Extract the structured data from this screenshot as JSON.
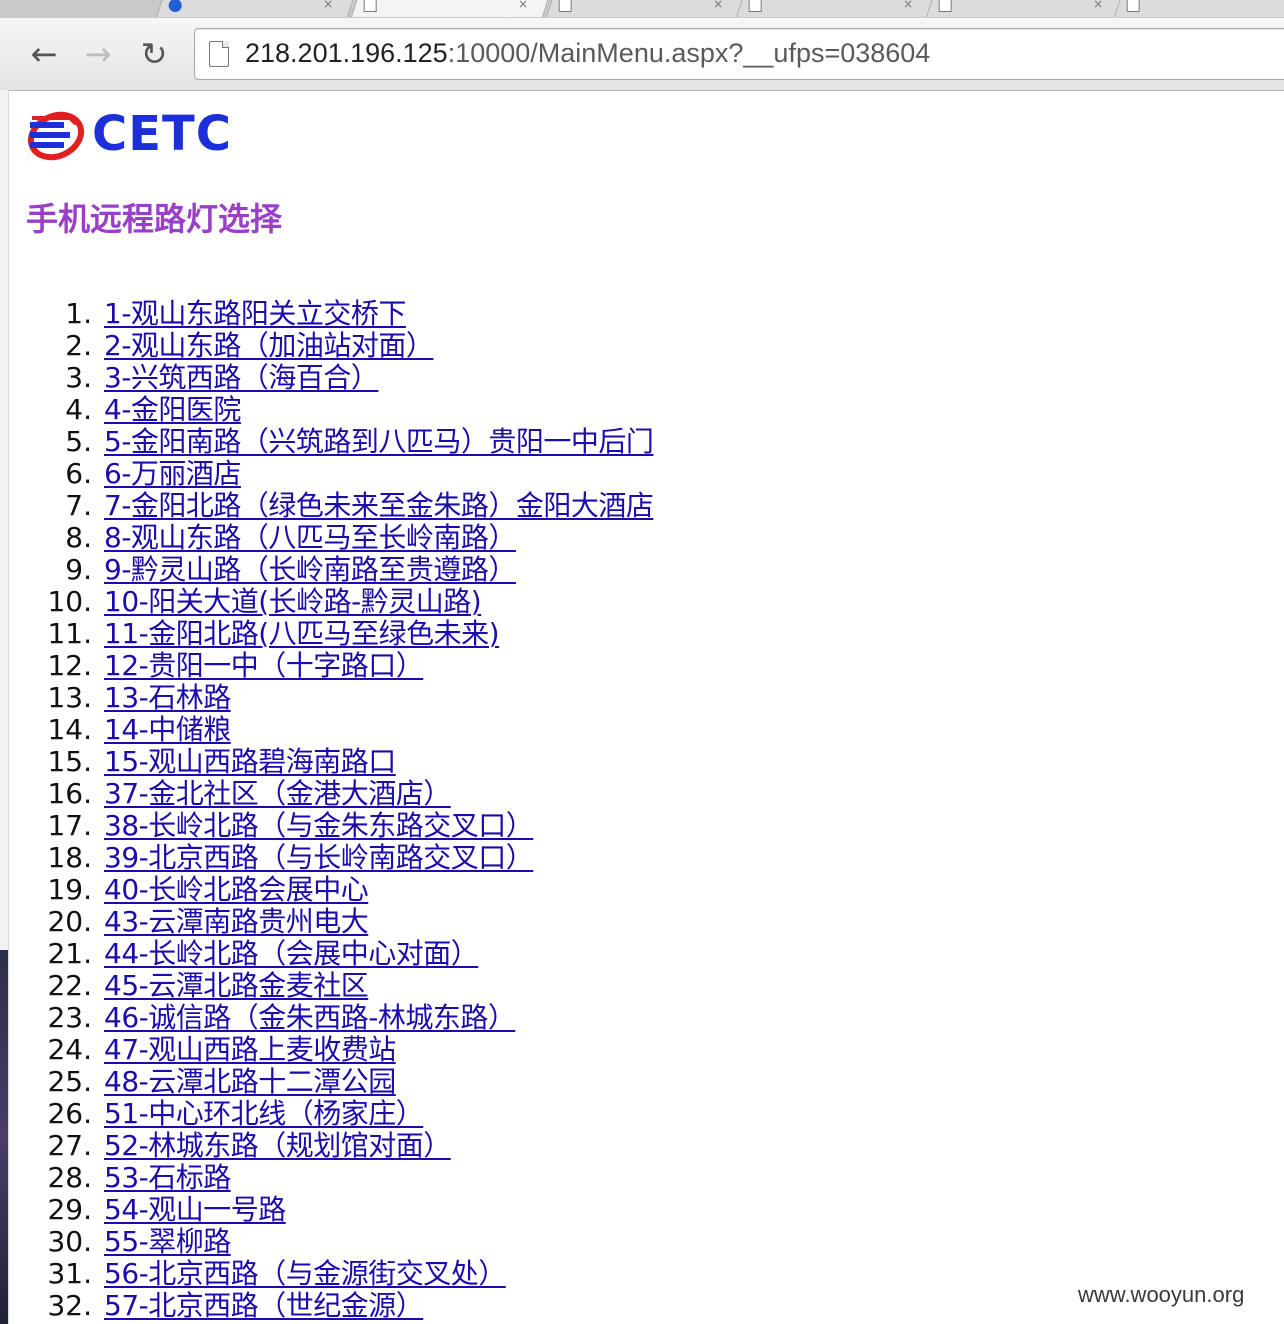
{
  "browser": {
    "tabs": [
      {
        "icon": "search-favicon-icon"
      },
      {
        "icon": "page-icon"
      },
      {
        "icon": "page-icon"
      },
      {
        "icon": "page-icon"
      },
      {
        "icon": "page-icon"
      },
      {
        "icon": "page-icon"
      }
    ],
    "url_host": "218.201.196.125",
    "url_rest": ":10000/MainMenu.aspx?__ufps=038604",
    "back_glyph": "←",
    "forward_glyph": "→",
    "reload_glyph": "↻"
  },
  "logo": {
    "text": "CETC",
    "brand_color": "#1c2fd8",
    "swoosh_color": "#e02020"
  },
  "page": {
    "title": "手机远程路灯选择",
    "title_color": "#9b3fc9",
    "link_color": "#1a0dab"
  },
  "roads": [
    {
      "num": "1.",
      "label": "1-观山东路阳关立交桥下"
    },
    {
      "num": "2.",
      "label": "2-观山东路（加油站对面）"
    },
    {
      "num": "3.",
      "label": "3-兴筑西路（海百合）"
    },
    {
      "num": "4.",
      "label": "4-金阳医院"
    },
    {
      "num": "5.",
      "label": "5-金阳南路（兴筑路到八匹马）贵阳一中后门"
    },
    {
      "num": "6.",
      "label": "6-万丽酒店"
    },
    {
      "num": "7.",
      "label": "7-金阳北路（绿色未来至金朱路）金阳大酒店"
    },
    {
      "num": "8.",
      "label": "8-观山东路（八匹马至长岭南路）"
    },
    {
      "num": "9.",
      "label": "9-黔灵山路（长岭南路至贵遵路）"
    },
    {
      "num": "10.",
      "label": "10-阳关大道(长岭路-黔灵山路)"
    },
    {
      "num": "11.",
      "label": "11-金阳北路(八匹马至绿色未来)"
    },
    {
      "num": "12.",
      "label": "12-贵阳一中（十字路口）"
    },
    {
      "num": "13.",
      "label": "13-石林路"
    },
    {
      "num": "14.",
      "label": "14-中储粮"
    },
    {
      "num": "15.",
      "label": "15-观山西路碧海南路口"
    },
    {
      "num": "16.",
      "label": "37-金北社区（金港大酒店）"
    },
    {
      "num": "17.",
      "label": "38-长岭北路（与金朱东路交叉口）"
    },
    {
      "num": "18.",
      "label": "39-北京西路（与长岭南路交叉口）"
    },
    {
      "num": "19.",
      "label": "40-长岭北路会展中心"
    },
    {
      "num": "20.",
      "label": "43-云潭南路贵州电大"
    },
    {
      "num": "21.",
      "label": "44-长岭北路（会展中心对面）"
    },
    {
      "num": "22.",
      "label": "45-云潭北路金麦社区"
    },
    {
      "num": "23.",
      "label": "46-诚信路（金朱西路-林城东路）"
    },
    {
      "num": "24.",
      "label": "47-观山西路上麦收费站"
    },
    {
      "num": "25.",
      "label": "48-云潭北路十二潭公园"
    },
    {
      "num": "26.",
      "label": "51-中心环北线（杨家庄）"
    },
    {
      "num": "27.",
      "label": "52-林城东路（规划馆对面）"
    },
    {
      "num": "28.",
      "label": "53-石标路"
    },
    {
      "num": "29.",
      "label": "54-观山一号路"
    },
    {
      "num": "30.",
      "label": "55-翠柳路"
    },
    {
      "num": "31.",
      "label": "56-北京西路（与金源街交叉处）"
    },
    {
      "num": "32.",
      "label": "57-北京西路（世纪金源）"
    }
  ],
  "watermark": "www.wooyun.org"
}
